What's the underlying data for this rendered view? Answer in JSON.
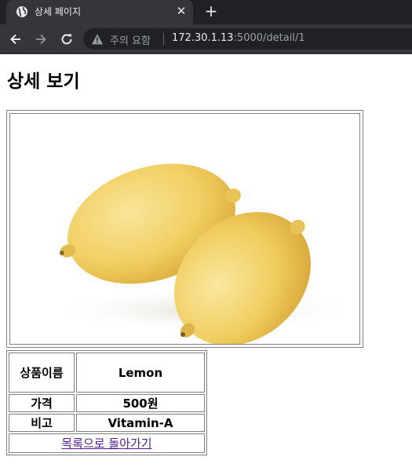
{
  "browser": {
    "tab_title": "상세 페이지",
    "new_tab": "+",
    "close_symbol": "✕",
    "security_label": "주의 요함",
    "url_host": "172.30.1.13",
    "url_rest": ":5000/detail/1"
  },
  "page": {
    "title": "상세 보기",
    "image_subject": "lemons",
    "product": {
      "name_label": "상품이름",
      "name_value": "Lemon",
      "price_label": "가격",
      "price_value": "500원",
      "note_label": "비고",
      "note_value": "Vitamin-A"
    },
    "back_link": "목록으로 돌아가기"
  },
  "colors": {
    "chrome_dark": "#202124",
    "chrome_tab": "#35363a",
    "link_visited": "#551a8b",
    "lemon": "#f2d36b"
  }
}
